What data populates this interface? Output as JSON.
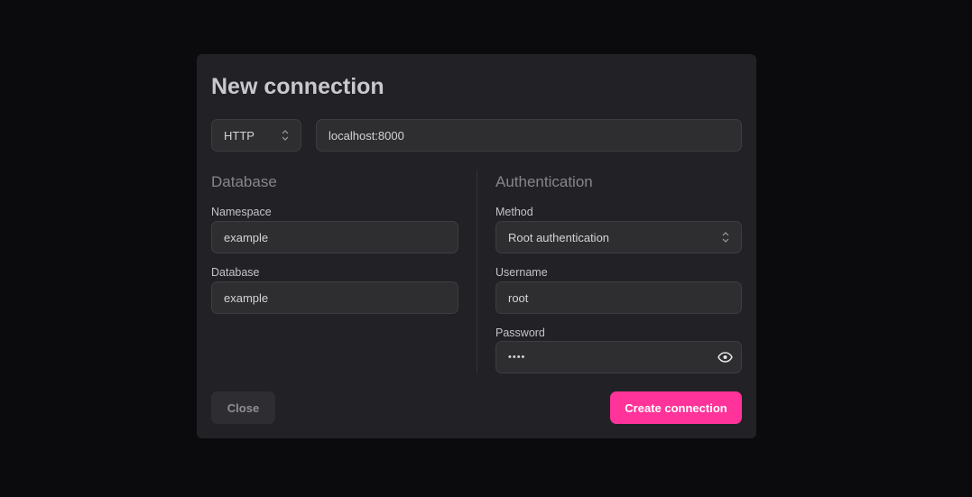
{
  "dialog": {
    "title": "New connection"
  },
  "endpoint": {
    "protocol": "HTTP",
    "url": "localhost:8000"
  },
  "database": {
    "heading": "Database",
    "namespace_label": "Namespace",
    "namespace_value": "example",
    "database_label": "Database",
    "database_value": "example"
  },
  "auth": {
    "heading": "Authentication",
    "method_label": "Method",
    "method_value": "Root authentication",
    "username_label": "Username",
    "username_value": "root",
    "password_label": "Password",
    "password_value": "••••",
    "password_toggle_icon": "eye-icon"
  },
  "actions": {
    "close": "Close",
    "create": "Create connection"
  },
  "colors": {
    "accent": "#ff3399",
    "background": "#0b0b0d",
    "dialog": "#222226"
  }
}
